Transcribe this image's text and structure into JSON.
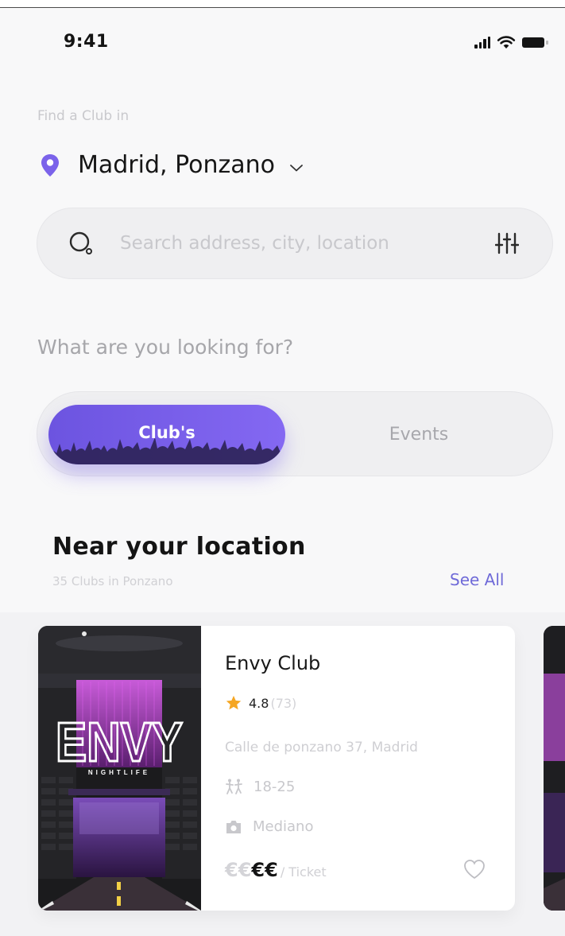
{
  "status_bar": {
    "time": "9:41",
    "icons": [
      "signal-icon",
      "wifi-icon",
      "battery-icon"
    ]
  },
  "location": {
    "label": "Find a Club in",
    "value": "Madrid, Ponzano",
    "icon": "pin-icon",
    "accent_color": "#7b63ea"
  },
  "search": {
    "placeholder": "Search address, city, location",
    "value": "",
    "icons": [
      "search-icon",
      "filter-icon"
    ]
  },
  "category": {
    "question": "What are you looking for?",
    "tabs": [
      {
        "label": "Club's",
        "selected": true
      },
      {
        "label": "Events",
        "selected": false
      }
    ]
  },
  "nearby": {
    "title": "Near your location",
    "subtitle": "35 Clubs in Ponzano",
    "see_all": "See All",
    "clubs": [
      {
        "name": "Envy Club",
        "image_sign": "ENVY",
        "image_subsign": "NIGHTLIFE",
        "rating": "4.8",
        "rating_count": "(73)",
        "address": "Calle de ponzano 37,  Madrid",
        "age_range": "18-25",
        "size": "Mediano",
        "price_low": "€€",
        "price_high": "€€",
        "price_suffix": "/ Ticket",
        "favorite": false
      }
    ]
  },
  "colors": {
    "accent": "#7b63ea",
    "link": "#6f6ad8",
    "star": "#f5a623"
  }
}
